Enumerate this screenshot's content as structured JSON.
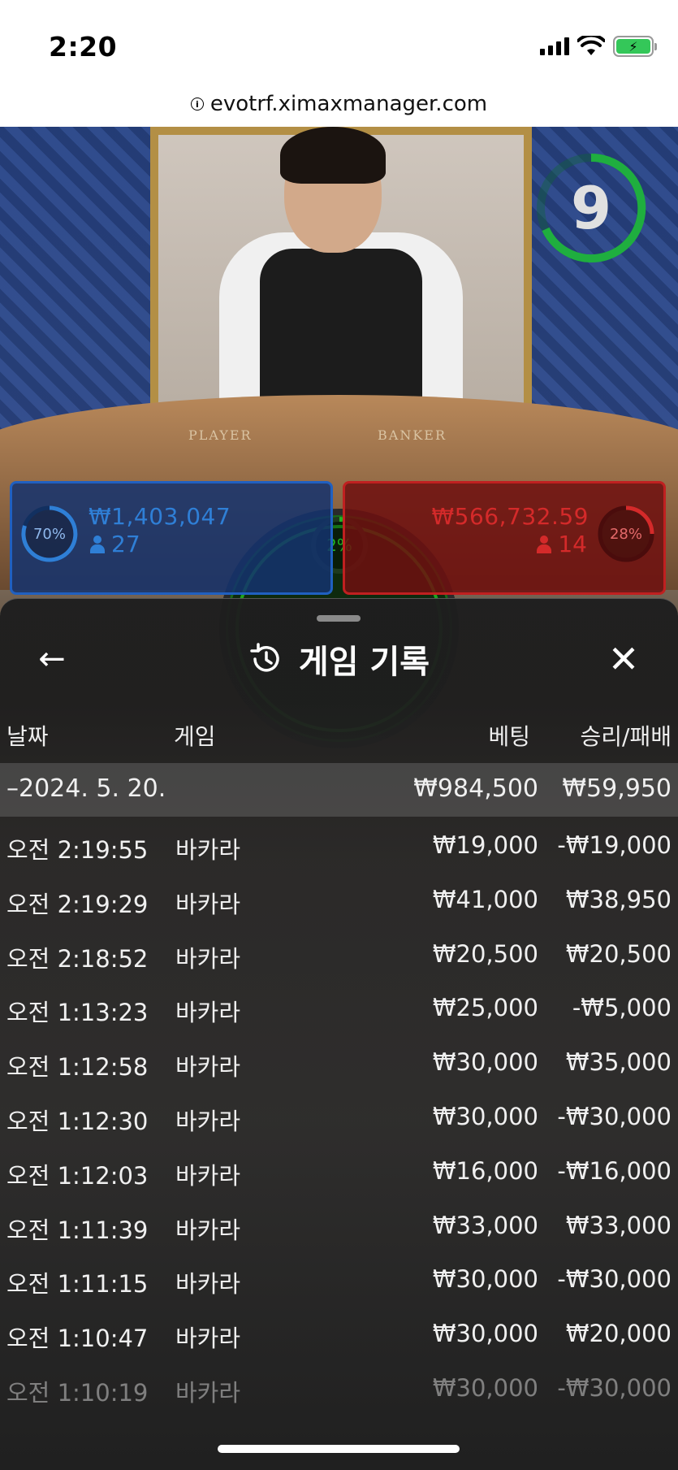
{
  "status_bar": {
    "time": "2:20",
    "battery_glyph": "⚡"
  },
  "browser": {
    "url": "evotrf.ximaxmanager.com",
    "info_glyph": "i"
  },
  "game_view": {
    "table_labels": {
      "player": "PLAYER",
      "banker": "BANKER"
    },
    "countdown": "9",
    "player_bet": {
      "percent": "70%",
      "amount": "₩1,403,047",
      "count": "27",
      "color": "#2f7fd6"
    },
    "banker_bet": {
      "percent": "28%",
      "amount": "₩566,732.59",
      "count": "14",
      "color": "#d42a2a"
    },
    "tie_bet": {
      "percent": "2%",
      "color": "#22b322"
    }
  },
  "sheet": {
    "title": "게임 기록",
    "back_glyph": "←",
    "close_glyph": "✕",
    "columns": {
      "date": "날짜",
      "game": "게임",
      "bet": "베팅",
      "result": "승리/패배"
    },
    "summary": {
      "date": "–2024. 5. 20.",
      "bet": "₩984,500",
      "result": "₩59,950"
    },
    "rows": [
      {
        "time": "오전 2:19:55",
        "game": "바카라",
        "bet": "₩19,000",
        "result": "-₩19,000"
      },
      {
        "time": "오전 2:19:29",
        "game": "바카라",
        "bet": "₩41,000",
        "result": "₩38,950"
      },
      {
        "time": "오전 2:18:52",
        "game": "바카라",
        "bet": "₩20,500",
        "result": "₩20,500"
      },
      {
        "time": "오전 1:13:23",
        "game": "바카라",
        "bet": "₩25,000",
        "result": "-₩5,000"
      },
      {
        "time": "오전 1:12:58",
        "game": "바카라",
        "bet": "₩30,000",
        "result": "₩35,000"
      },
      {
        "time": "오전 1:12:30",
        "game": "바카라",
        "bet": "₩30,000",
        "result": "-₩30,000"
      },
      {
        "time": "오전 1:12:03",
        "game": "바카라",
        "bet": "₩16,000",
        "result": "-₩16,000"
      },
      {
        "time": "오전 1:11:39",
        "game": "바카라",
        "bet": "₩33,000",
        "result": "₩33,000"
      },
      {
        "time": "오전 1:11:15",
        "game": "바카라",
        "bet": "₩30,000",
        "result": "-₩30,000"
      },
      {
        "time": "오전 1:10:47",
        "game": "바카라",
        "bet": "₩30,000",
        "result": "₩20,000"
      },
      {
        "time": "오전 1:10:19",
        "game": "바카라",
        "bet": "₩30,000",
        "result": "-₩30,000"
      }
    ]
  }
}
